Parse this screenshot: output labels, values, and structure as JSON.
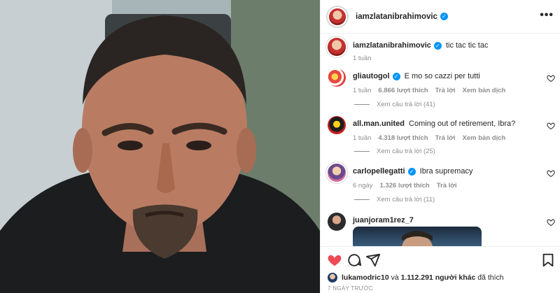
{
  "post": {
    "author": "iamzlatanibrahimovic",
    "caption": "tic tac tic tac",
    "caption_time": "1 tuần",
    "more_menu": "•••"
  },
  "comments": [
    {
      "user": "gliautogol",
      "verified": true,
      "text": "E mo so cazzi per tutti",
      "time": "1 tuần",
      "likes": "6.866 lượt thích",
      "reply": "Trả lời",
      "translate": "Xem bản dịch",
      "view_replies": "Xem câu trả lời (41)"
    },
    {
      "user": "all.man.united",
      "verified": false,
      "text": "Coming out of retirement, Ibra?",
      "time": "1 tuần",
      "likes": "4.318 lượt thích",
      "reply": "Trả lời",
      "translate": "Xem bản dịch",
      "view_replies": "Xem câu trả lời (25)"
    },
    {
      "user": "carlopellegatti",
      "verified": true,
      "text": "Ibra supremacy",
      "time": "6 ngày",
      "likes": "1.326 lượt thích",
      "reply": "Trả lời",
      "view_replies": "Xem câu trả lời (11)"
    },
    {
      "user": "juanjoram1rez_7",
      "verified": false,
      "text": ""
    }
  ],
  "likes": {
    "user": "lukamodric10",
    "connector": "và",
    "others": "1.112.291 người khác",
    "suffix": "đã thích"
  },
  "date": "7 NGÀY TRƯỚC",
  "colors": {
    "heart_filled": "#ed4956",
    "verified_blue": "#0095f6",
    "secondary_text": "#8e8e8e"
  },
  "icons": [
    "heart-icon",
    "comment-icon",
    "share-icon",
    "bookmark-icon",
    "more-icon",
    "small-heart-icon",
    "verified-badge-icon"
  ]
}
